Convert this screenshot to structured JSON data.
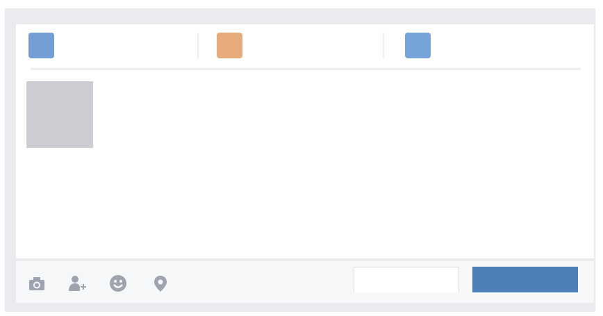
{
  "composer": {
    "tabs": [
      {
        "icon": "status-icon",
        "label": "",
        "color": "#749fd6"
      },
      {
        "icon": "photo-icon",
        "label": "",
        "color": "#e5ab79"
      },
      {
        "icon": "album-icon",
        "label": "",
        "color": "#76a3d8"
      }
    ],
    "text_value": "",
    "placeholder": ""
  },
  "footer": {
    "icons": [
      "camera-icon",
      "tag-friends-icon",
      "feeling-icon",
      "location-icon"
    ],
    "secondary_label": "",
    "primary_label": ""
  },
  "colors": {
    "frame_bg": "#e9ebee",
    "card_bg": "#ffffff",
    "footer_bg": "#f6f7f9",
    "avatar_placeholder": "#cbcdd3",
    "icon_gray": "#9da3af",
    "primary": "#4f7fb8"
  }
}
